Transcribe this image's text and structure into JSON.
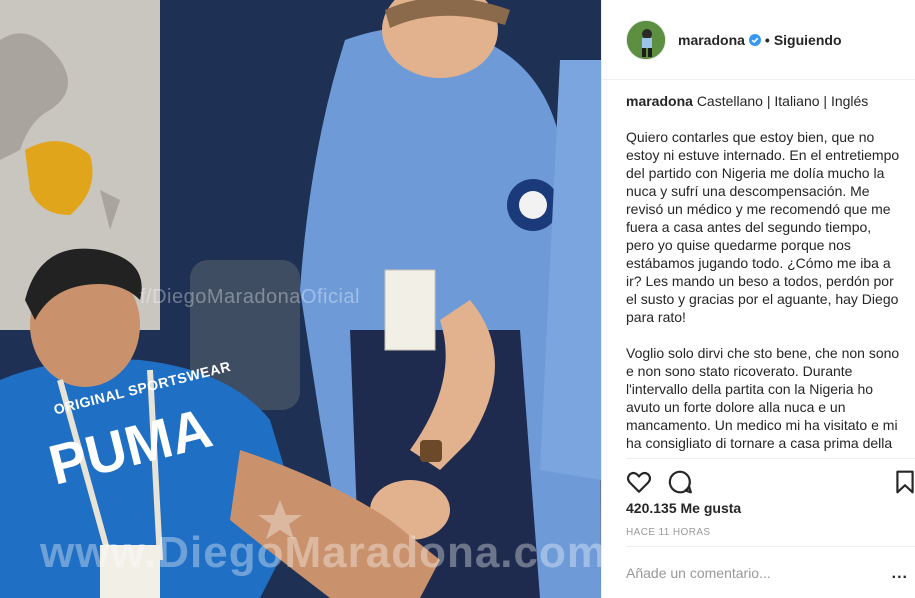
{
  "photo": {
    "alt": "",
    "watermark": "f/DiegoMaradonaOficial",
    "watermark_bottom": "www.DiegoMaradona.com",
    "shirt_text": "ORIGINAL SPORTSWEAR"
  },
  "header": {
    "username": "maradona",
    "separator": "•",
    "follow_state": "Siguiendo",
    "verified_icon": "verified-badge-icon",
    "accent": "#3897f0"
  },
  "caption": {
    "username": "maradona",
    "languages": "Castellano | Italiano | Inglés",
    "paragraph_es": "Quiero contarles que estoy bien, que no estoy ni estuve internado. En el entretiempo del partido con Nigeria me dolía mucho la nuca y sufrí una descompensación. Me revisó un médico y me recomendó que me fuera a casa antes del segundo tiempo, pero yo quise quedarme porque nos estábamos jugando todo. ¿Cómo me iba a ir? Les mando un beso a todos, perdón por el susto y gracias por el aguante, hay Diego para rato!",
    "paragraph_it": "Voglio solo dirvi che sto bene, che non sono e non sono stato ricoverato. Durante l'intervallo della partita con la Nigeria ho avuto un forte dolore alla nuca e un mancamento. Un medico mi ha visitato e mi ha consigliato di tornare a casa prima della seconda tempo, ma ho voluto"
  },
  "actions": {
    "like_icon": "heart-icon",
    "comment_icon": "comment-bubble-icon",
    "save_icon": "bookmark-icon"
  },
  "likes": {
    "text": "420.135 Me gusta"
  },
  "time": {
    "text": "HACE 11 HORAS"
  },
  "comment": {
    "placeholder": "Añade un comentario...",
    "more": "..."
  }
}
